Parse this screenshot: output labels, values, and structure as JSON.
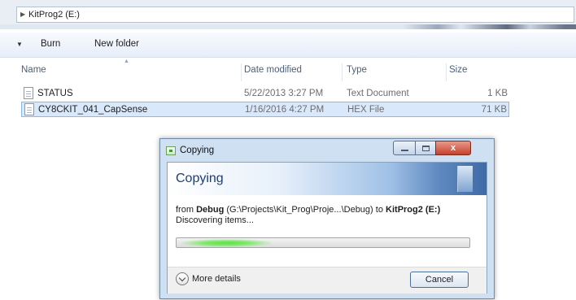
{
  "address_bar": {
    "path": "KitProg2 (E:)"
  },
  "toolbar": {
    "burn_label": "Burn",
    "new_folder_label": "New folder"
  },
  "columns": {
    "name": "Name",
    "date": "Date modified",
    "type": "Type",
    "size": "Size"
  },
  "files": [
    {
      "name": "STATUS",
      "date": "5/22/2013 3:27 PM",
      "type": "Text Document",
      "size": "1 KB",
      "selected": false
    },
    {
      "name": "CY8CKIT_041_CapSense",
      "date": "1/16/2016 4:27 PM",
      "type": "HEX File",
      "size": "71 KB",
      "selected": true
    }
  ],
  "dialog": {
    "title": "Copying",
    "heading": "Copying",
    "from_prefix": "from",
    "source_name": "Debug",
    "source_path": "(G:\\Projects\\Kit_Prog\\Proje...\\Debug)",
    "to_word": "to",
    "dest_name": "KitProg2 (E:)",
    "status": "Discovering items...",
    "more_details_label": "More details",
    "cancel_label": "Cancel",
    "close_glyph": "x",
    "progress_fraction": 0.3
  },
  "icons": {
    "address_arrow": "caret-right-icon",
    "toolbar_arrow": "caret-down-icon",
    "file": "text-file-icon",
    "hex_file": "hex-file-icon",
    "copy_dialog": "copy-dialog-icon",
    "more_details": "chevron-down-circle-icon"
  }
}
